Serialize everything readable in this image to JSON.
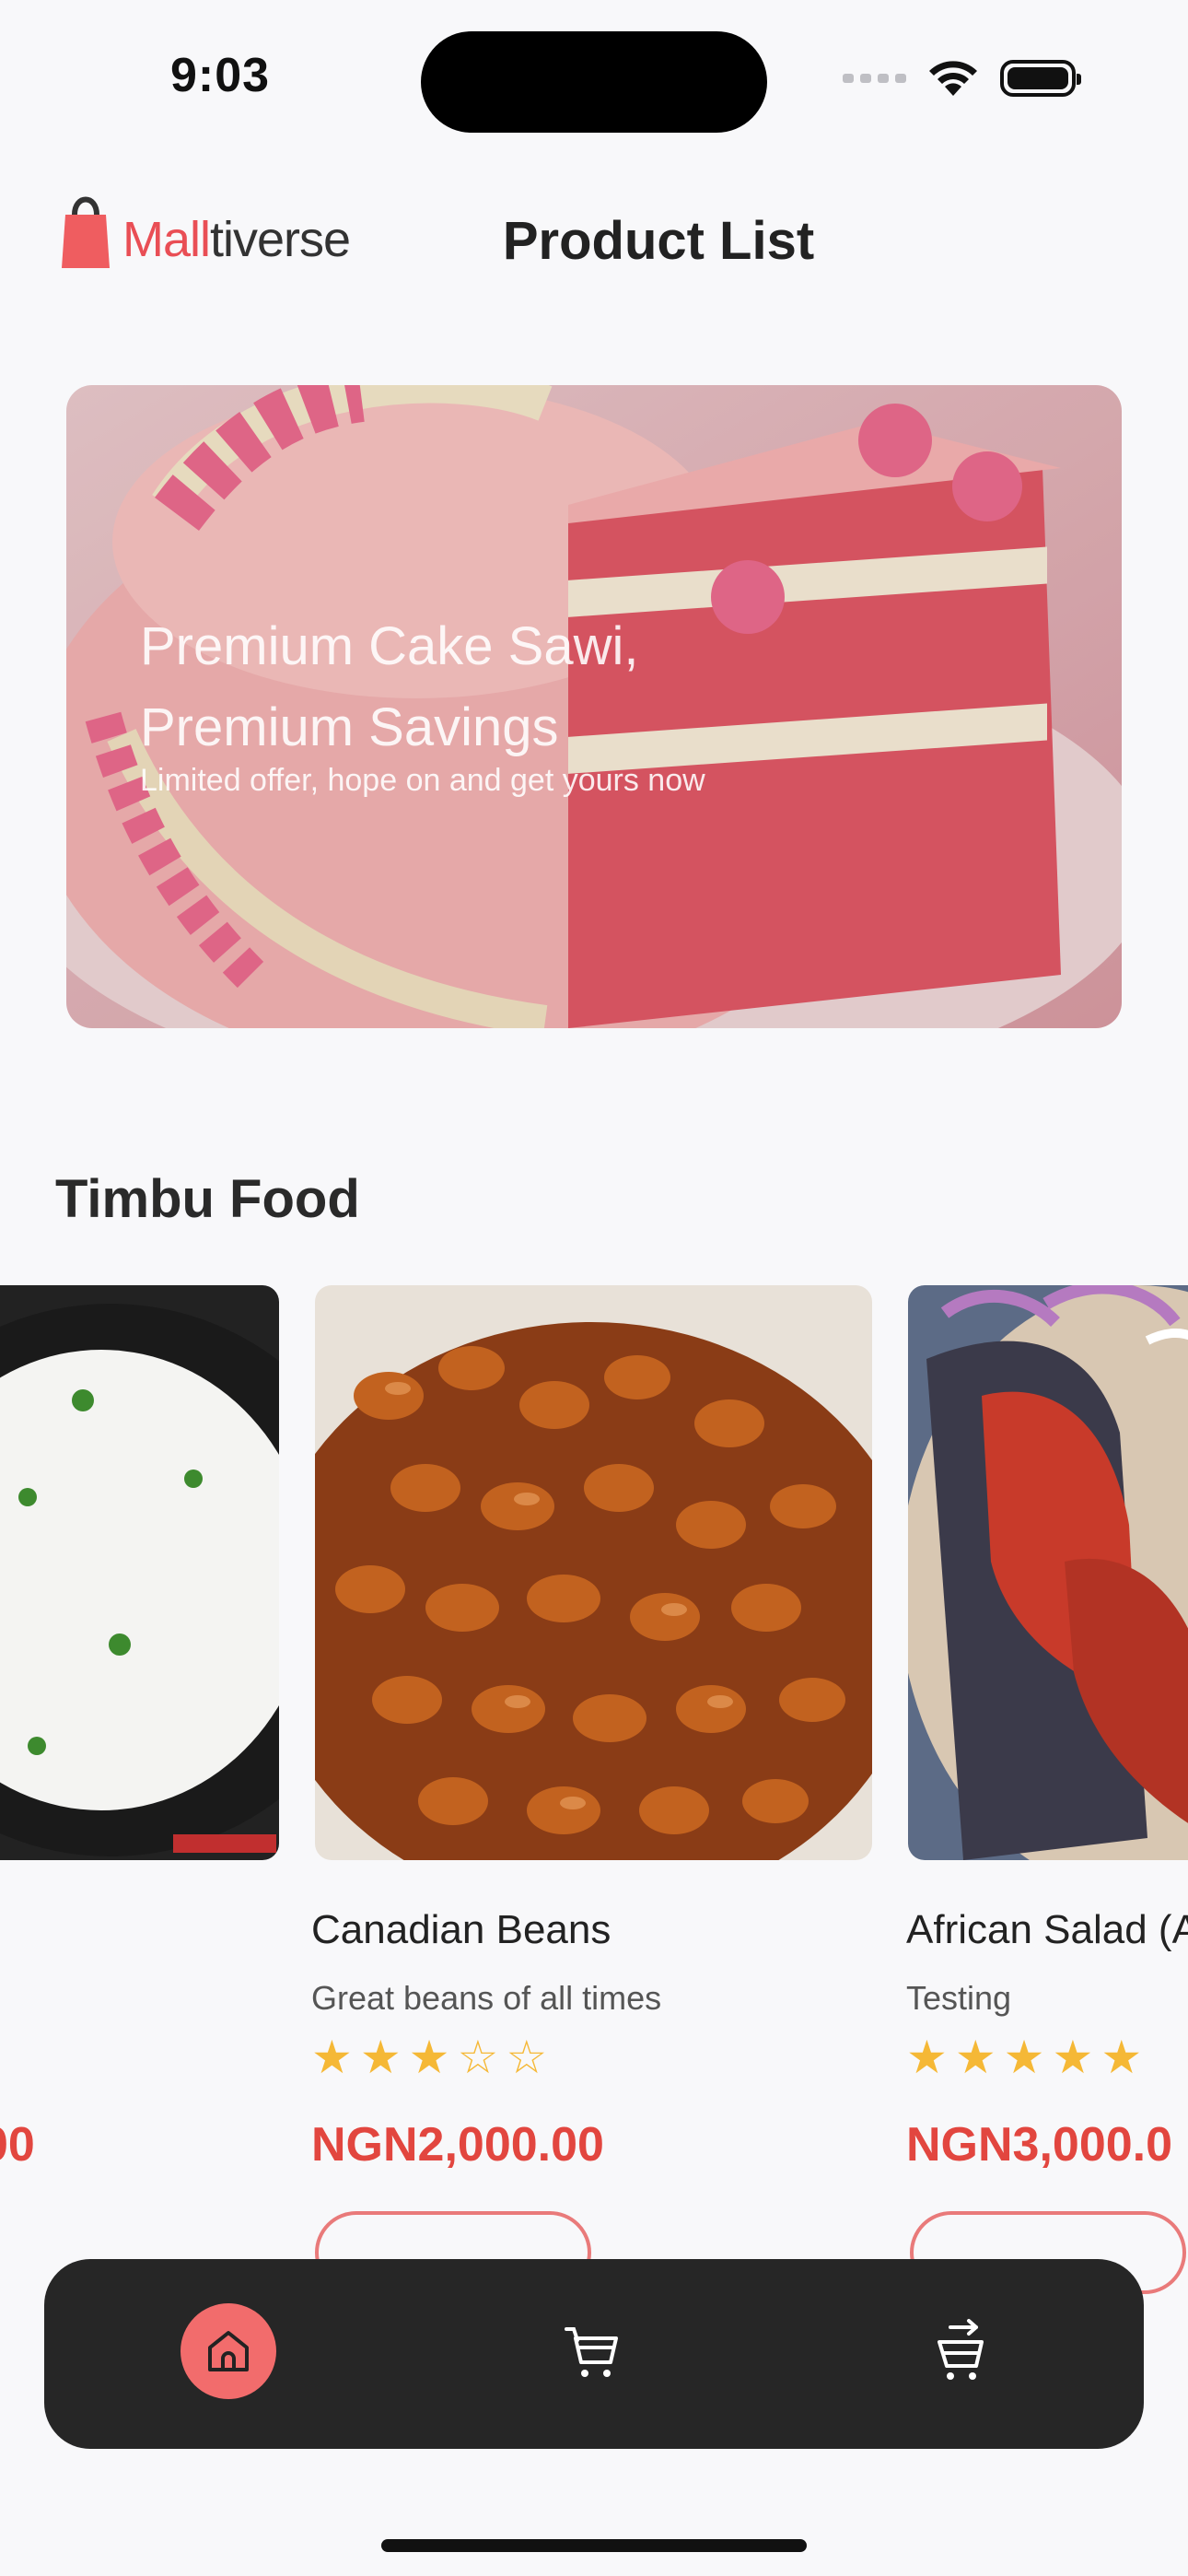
{
  "status_bar": {
    "time": "9:03"
  },
  "header": {
    "logo_part1": "Mall",
    "logo_part2": "tiverse",
    "title": "Product List"
  },
  "banner": {
    "title": "Premium Cake Sawi, Premium Savings",
    "subtitle": "Limited offer, hope on and get yours now"
  },
  "section": {
    "title": "Timbu Food"
  },
  "products": [
    {
      "name": "",
      "description": "",
      "rating": null,
      "price": "00",
      "image": "rice-image"
    },
    {
      "name": "Canadian Beans",
      "description": "Great beans of all times",
      "rating": 3,
      "price": "NGN2,000.00",
      "image": "beans-image"
    },
    {
      "name": "African Salad (A",
      "description": "Testing",
      "rating": 5,
      "price": "NGN3,000.0",
      "image": "fish-image"
    }
  ],
  "nav": {
    "items": [
      "home-icon",
      "cart-icon",
      "checkout-icon"
    ],
    "active": "home-icon"
  },
  "colors": {
    "accent": "#f26c6c",
    "price": "#e2463f",
    "star": "#f5b836",
    "nav_bg": "#262626"
  }
}
